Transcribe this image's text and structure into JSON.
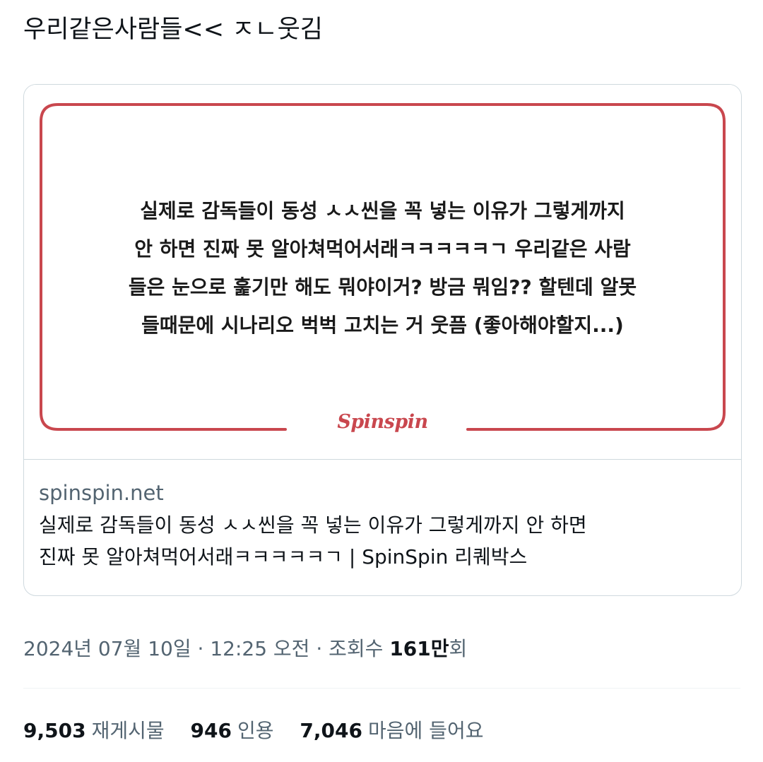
{
  "tweet": {
    "text": "우리같은사람들<< ㅈㄴ웃김"
  },
  "card": {
    "image_text": [
      "실제로 감독들이 동성 ㅅㅅ씬을 꼭 넣는 이유가 그렇게까지",
      "안 하면 진짜 못 알아쳐먹어서래ㅋㅋㅋㅋㅋㄱ 우리같은 사람",
      "들은 눈으로 훑기만 해도 뭐야이거? 방금 뭐임?? 할텐데 알못",
      "들때문에 시나리오 벅벅 고치는 거 웃픔 (좋아해야할지...)"
    ],
    "logo": "Spinspin",
    "domain": "spinspin.net",
    "title_lines": [
      "실제로 감독들이 동성 ㅅㅅ씬을 꼭 넣는 이유가 그렇게까지 안 하면",
      "진짜 못 알아쳐먹어서래ㅋㅋㅋㅋㅋㄱ | SpinSpin 리퀘박스"
    ]
  },
  "meta": {
    "date": "2024년 07월 10일",
    "separator": " · ",
    "time": "12:25 오전",
    "views_label": "조회수",
    "views_number": "161만",
    "views_suffix": "회"
  },
  "stats": {
    "retweets": {
      "count": "9,503",
      "label": "재게시물"
    },
    "quotes": {
      "count": "946",
      "label": "인용"
    },
    "likes": {
      "count": "7,046",
      "label": "마음에 들어요"
    }
  },
  "colors": {
    "frame": "#c9474e",
    "text_primary": "#0f1419",
    "text_secondary": "#536471",
    "border": "#cfd9de"
  }
}
